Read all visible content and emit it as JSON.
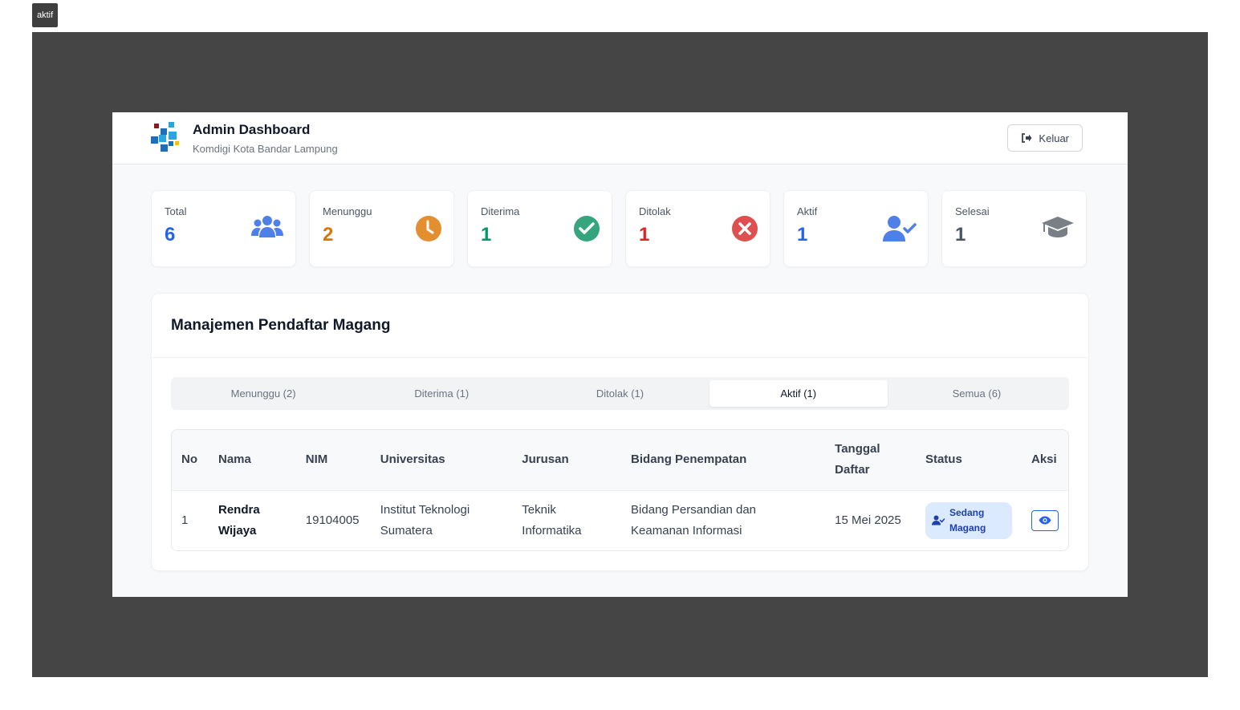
{
  "corner_label": "aktif",
  "header": {
    "title": "Admin Dashboard",
    "subtitle": "Komdigi Kota Bandar Lampung",
    "logout_label": "Keluar"
  },
  "stats": [
    {
      "label": "Total",
      "value": "6",
      "color": "#2563eb",
      "icon": "users-icon"
    },
    {
      "label": "Menunggu",
      "value": "2",
      "color": "#d97706",
      "icon": "clock-icon"
    },
    {
      "label": "Diterima",
      "value": "1",
      "color": "#059669",
      "icon": "check-circle-icon"
    },
    {
      "label": "Ditolak",
      "value": "1",
      "color": "#dc2626",
      "icon": "x-circle-icon"
    },
    {
      "label": "Aktif",
      "value": "1",
      "color": "#2563eb",
      "icon": "user-check-icon"
    },
    {
      "label": "Selesai",
      "value": "1",
      "color": "#4b5563",
      "icon": "graduation-cap-icon"
    }
  ],
  "main": {
    "title": "Manajemen Pendaftar Magang",
    "tabs": [
      {
        "label": "Menunggu (2)",
        "active": false
      },
      {
        "label": "Diterima (1)",
        "active": false
      },
      {
        "label": "Ditolak (1)",
        "active": false
      },
      {
        "label": "Aktif (1)",
        "active": true
      },
      {
        "label": "Semua (6)",
        "active": false
      }
    ],
    "table": {
      "headers": {
        "no": "No",
        "nama": "Nama",
        "nim": "NIM",
        "universitas": "Universitas",
        "jurusan": "Jurusan",
        "bidang": "Bidang Penempatan",
        "tanggal_1": "Tanggal",
        "tanggal_2": "Daftar",
        "status": "Status",
        "aksi": "Aksi"
      },
      "rows": [
        {
          "no": "1",
          "nama_1": "Rendra",
          "nama_2": "Wijaya",
          "nim": "19104005",
          "universitas_1": "Institut Teknologi",
          "universitas_2": "Sumatera",
          "jurusan_1": "Teknik",
          "jurusan_2": "Informatika",
          "bidang_1": "Bidang Persandian dan",
          "bidang_2": "Keamanan Informasi",
          "tanggal": "15 Mei 2025",
          "status_1": "Sedang",
          "status_2": "Magang"
        }
      ]
    }
  }
}
